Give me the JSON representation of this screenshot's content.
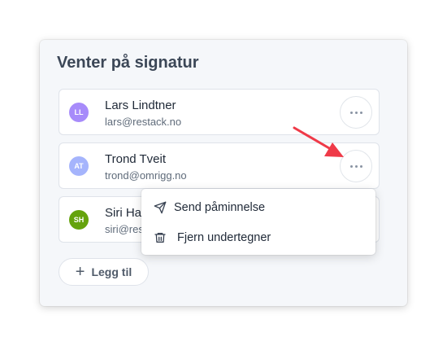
{
  "card": {
    "title": "Venter på signatur"
  },
  "signers": [
    {
      "initials": "LL",
      "name": "Lars Lindtner",
      "email": "lars@restack.no",
      "avatar_color": "#a78bfa"
    },
    {
      "initials": "AT",
      "name": "Trond Tveit",
      "email": "trond@omrigg.no",
      "avatar_color": "#a5b4fc"
    },
    {
      "initials": "SH",
      "name": "Siri Hau",
      "email": "siri@res",
      "avatar_color": "#65a30d"
    }
  ],
  "add_button": {
    "label": "Legg til",
    "icon": "plus-icon"
  },
  "context_menu": {
    "items": [
      {
        "label": "Send påminnelse",
        "icon": "send-icon"
      },
      {
        "label": "Fjern undertegner",
        "icon": "trash-icon"
      }
    ]
  },
  "colors": {
    "annotation_arrow": "#ef3a48",
    "card_background": "#f5f7fa",
    "title_text": "#3c4757"
  }
}
